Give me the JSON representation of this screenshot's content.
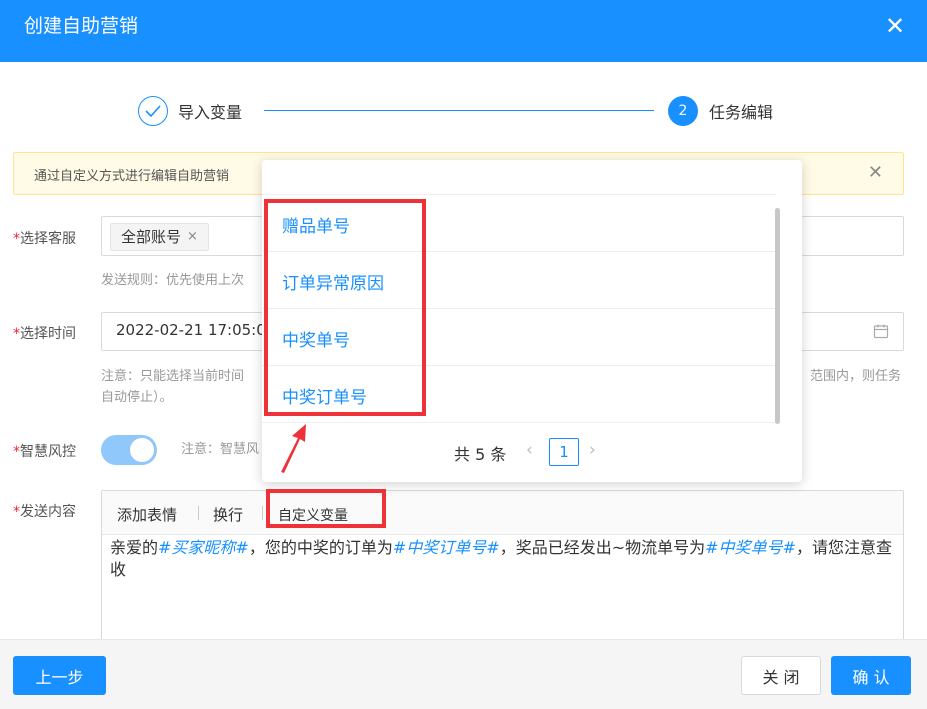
{
  "header": {
    "title": "创建自助营销",
    "close_glyph": "✕"
  },
  "steps": [
    {
      "label": "导入变量",
      "status": "done"
    },
    {
      "number": "2",
      "label": "任务编辑",
      "status": "active"
    }
  ],
  "alert": {
    "text": "通过自定义方式进行编辑自助营销",
    "close_glyph": "✕"
  },
  "form": {
    "account": {
      "label": "选择客服",
      "tag": "全部账号",
      "tag_close": "×",
      "hint": "发送规则：优先使用上次"
    },
    "time": {
      "label": "选择时间",
      "value": "2022-02-21 17:05:0",
      "hint1": "注意：只能选择当前时间",
      "hint2": "范围内，则任务",
      "hint3": "自动停止）。"
    },
    "risk": {
      "label": "智慧风控",
      "hint": "注意：智慧风"
    },
    "content": {
      "label": "发送内容"
    },
    "required_mark": "*"
  },
  "editor": {
    "toolbar": {
      "emoji": "添加表情",
      "newline": "换行",
      "custom_var": "自定义变量"
    },
    "content": {
      "t1": "亲爱的",
      "v1": "#买家昵称#",
      "t2": "，您的中奖的订单为",
      "v2": "#中奖订单号#",
      "t3": "，奖品已经发出~物流单号为",
      "v3": "#中奖单号#",
      "t4": "，请您注意查收"
    }
  },
  "popover": {
    "items": [
      "赠品单号",
      "订单异常原因",
      "中奖单号",
      "中奖订单号"
    ],
    "pager": {
      "total": "共 5 条",
      "page": "1",
      "prev": "‹",
      "next": "›"
    }
  },
  "footer": {
    "prev_label": "上一步",
    "close_label": "关 闭",
    "confirm_label": "确 认"
  },
  "colors": {
    "primary": "#1890ff",
    "highlight": "#ee3338",
    "required": "#f5222d"
  }
}
